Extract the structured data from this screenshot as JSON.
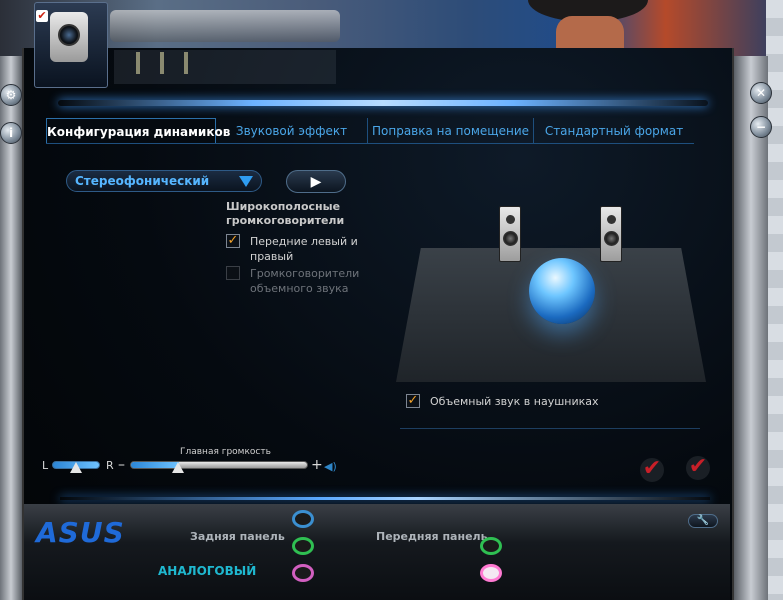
{
  "tabs": [
    "Конфигурация динамиков",
    "Звуковой эффект",
    "Поправка на помещение",
    "Стандартный формат"
  ],
  "config": {
    "speaker_mode": "Стереофонический",
    "fullrange_title": "Широкополосные громкоговорители",
    "front_label": "Передние левый и правый",
    "front_checked": true,
    "surround_label": "Громкоговорители объемного звука",
    "surround_checked": false,
    "headphone_label": "Объемный звук в наушниках",
    "headphone_checked": true
  },
  "volume": {
    "left_label": "L",
    "right_label": "R",
    "caption": "Главная громкость",
    "balance_fraction": 0.5,
    "level_fraction": 0.27
  },
  "bottom": {
    "brand": "ASUS",
    "rear_panel": "Задняя панель",
    "front_panel": "Передняя панель",
    "analog": "АНАЛОГОВЫЙ"
  },
  "colors": {
    "accent": "#2f9cf0",
    "checkmark": "#f2a22a",
    "brand": "#1f6ad8",
    "jack_blue": "#3b8fd0",
    "jack_green": "#2fbf52",
    "jack_pink": "#d25fc0"
  }
}
